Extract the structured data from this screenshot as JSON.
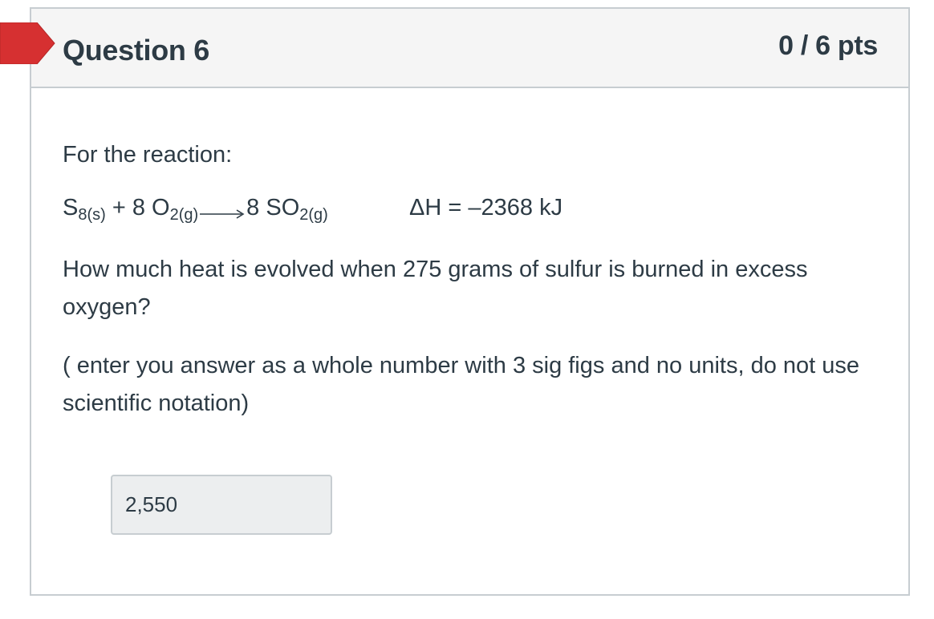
{
  "question": {
    "title": "Question 6",
    "points": "0 / 6 pts",
    "intro": "For the reaction:",
    "reaction": {
      "reactant1": "S",
      "reactant1_sub": "8(s)",
      "plus": " + 8 O",
      "reactant2_sub": "2(g)",
      "product": "8 SO",
      "product_sub": "2(g)",
      "enthalpy": "ΔH = –2368 kJ"
    },
    "text": "How much heat is evolved when 275 grams of sulfur is burned in excess oxygen?",
    "instructions": "( enter you answer as a whole number with 3 sig figs and no units, do not use scientific notation)",
    "answer_value": "2,550"
  },
  "colors": {
    "marker": "#d63031",
    "header_bg": "#f5f5f5",
    "border": "#c7cdd1",
    "text": "#2d3b45"
  },
  "icons": {
    "marker": "incorrect-answer-marker",
    "arrow": "reaction-arrow-icon"
  }
}
